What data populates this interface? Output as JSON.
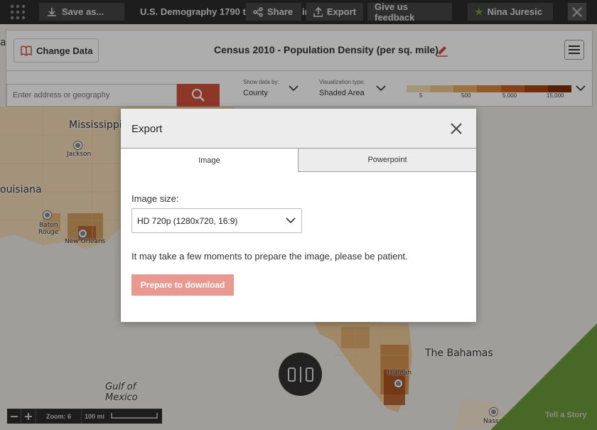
{
  "topbar": {
    "save_label": "Save as...",
    "title": "U.S. Demography 1790 to",
    "title_tail": "ir",
    "share_label": "Share",
    "export_label": "Export",
    "feedback_label": "Give us feedback",
    "user_name": "Nina Juresic"
  },
  "header": {
    "change_data_label": "Change Data",
    "map_title": "Census 2010 - Population Density (per sq. mile)"
  },
  "controls": {
    "search_placeholder": "Enter address or geography",
    "show_data_by_label": "Show data by:",
    "show_data_by_value": "County",
    "viz_type_label": "Visualization type:",
    "viz_type_value": "Shaded Area",
    "legend_ticks": [
      "5",
      "500",
      "5,000",
      "15,000"
    ],
    "legend_colors": [
      "#f3dcb3",
      "#efc88b",
      "#e6a95e",
      "#d9853a",
      "#c7611f",
      "#a9430f",
      "#7f2d06"
    ]
  },
  "map": {
    "labels": {
      "mississippi": "Mississippi",
      "louisiana": "ouisiana",
      "jackson": "Jackson",
      "baton": "Baton",
      "rouge": "Rouge",
      "new_orleans": "New Orleans",
      "gulf1": "Gulf of",
      "gulf2": "Mexico",
      "bahamas": "The Bahamas",
      "hialeah": "Hialeah",
      "nassau": "Nassau",
      "edge_a": "a"
    }
  },
  "modal": {
    "title": "Export",
    "tabs": [
      "Image",
      "Powerpoint"
    ],
    "size_label": "Image size:",
    "size_value": "HD 720p (1280x720, 16:9)",
    "patience_text": "It may take a few moments to prepare the image, please be patient.",
    "prepare_label": "Prepare to download"
  },
  "bottom": {
    "zoom_label": "Zoom: 6",
    "scale_label": "100 mi",
    "tell_story": "Tell a Story"
  }
}
